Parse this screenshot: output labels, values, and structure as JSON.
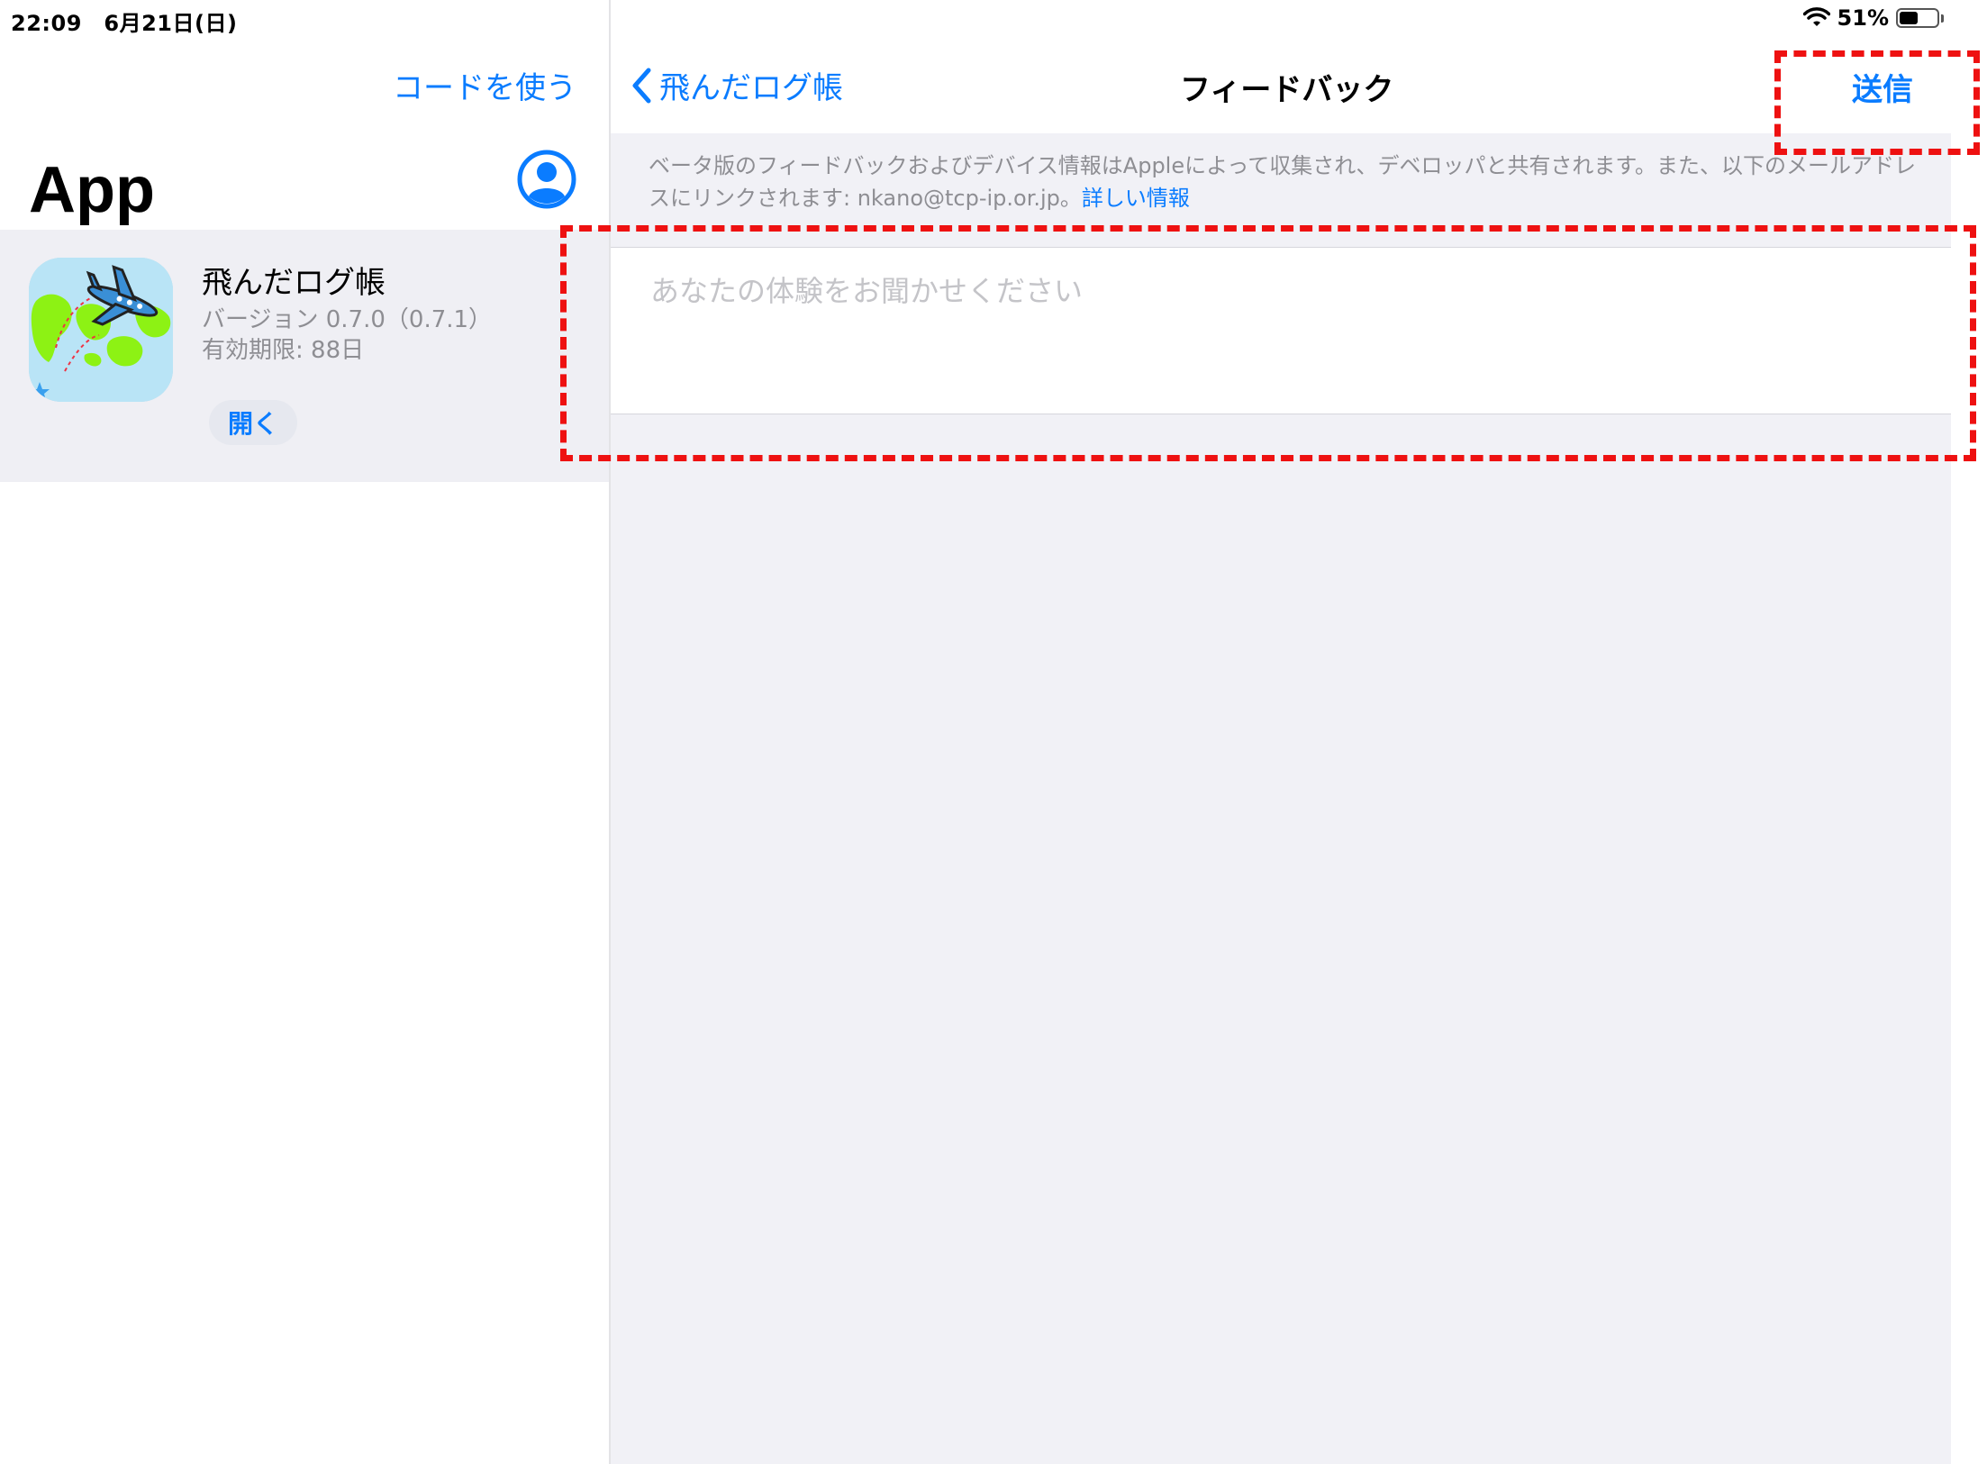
{
  "status_bar": {
    "time_date": "22:09　6月21日(日)",
    "battery": "51%",
    "battery_level": 0.51
  },
  "left_pane": {
    "redeem_code": "コードを使う",
    "title": "App",
    "app": {
      "name": "飛んだログ帳",
      "version": "バージョン 0.7.0（0.7.1）",
      "expiry": "有効期限: 88日",
      "open_button": "開く"
    }
  },
  "nav": {
    "back_label": "飛んだログ帳",
    "title": "フィードバック",
    "send_label": "送信"
  },
  "feedback": {
    "info_text": "ベータ版のフィードバックおよびデバイス情報はAppleによって収集され、デベロッパと共有されます。また、以下のメールアドレスにリンクされます: nkano@tcp-ip.or.jp。",
    "info_link": "詳しい情報",
    "placeholder": "あなたの体験をお聞かせください"
  },
  "colors": {
    "accent": "#0a7cff",
    "highlight": "#ee1111",
    "secondary_text": "#8e8e93",
    "grouped_background": "#f1f1f6"
  }
}
